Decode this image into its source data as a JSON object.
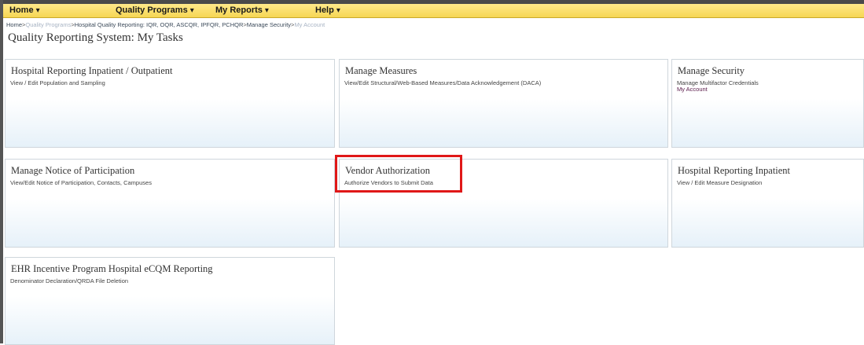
{
  "menu": {
    "items": [
      {
        "label": "Home"
      },
      {
        "label": "Quality Programs"
      },
      {
        "label": "My Reports"
      },
      {
        "label": "Help"
      }
    ]
  },
  "breadcrumb": {
    "items": [
      {
        "label": "Home"
      },
      {
        "label": "Quality Programs"
      },
      {
        "label": "Hospital Quality Reporting: IQR, OQR, ASCQR, IPFQR, PCHQR"
      },
      {
        "label": "Manage Security"
      }
    ],
    "current": "My Account",
    "separator": ">"
  },
  "page": {
    "title": "Quality Reporting System: My Tasks"
  },
  "tiles": [
    {
      "title": "Hospital Reporting Inpatient / Outpatient",
      "links": [
        "View / Edit Population and Sampling"
      ]
    },
    {
      "title": "Manage Measures",
      "links": [
        "View/Edit Structural/Web-Based Measures/Data Acknowledgement (DACA)"
      ]
    },
    {
      "title": "Manage Security",
      "links": [
        "Manage Multifactor Credentials",
        "My Account"
      ]
    },
    {
      "title": "Manage Notice of Participation",
      "links": [
        "View/Edit Notice of Participation, Contacts, Campuses"
      ]
    },
    {
      "title": "Vendor Authorization",
      "links": [
        "Authorize Vendors to Submit Data"
      ]
    },
    {
      "title": "Hospital Reporting Inpatient",
      "links": [
        "View / Edit Measure Designation"
      ]
    },
    {
      "title": "EHR Incentive Program Hospital eCQM Reporting",
      "links": [
        "Denominator Declaration/QRDA File Deletion"
      ]
    }
  ],
  "colors": {
    "menubar": "#f6d654",
    "highlight": "#e01818",
    "tile_gradient_end": "#e6f1f9"
  }
}
